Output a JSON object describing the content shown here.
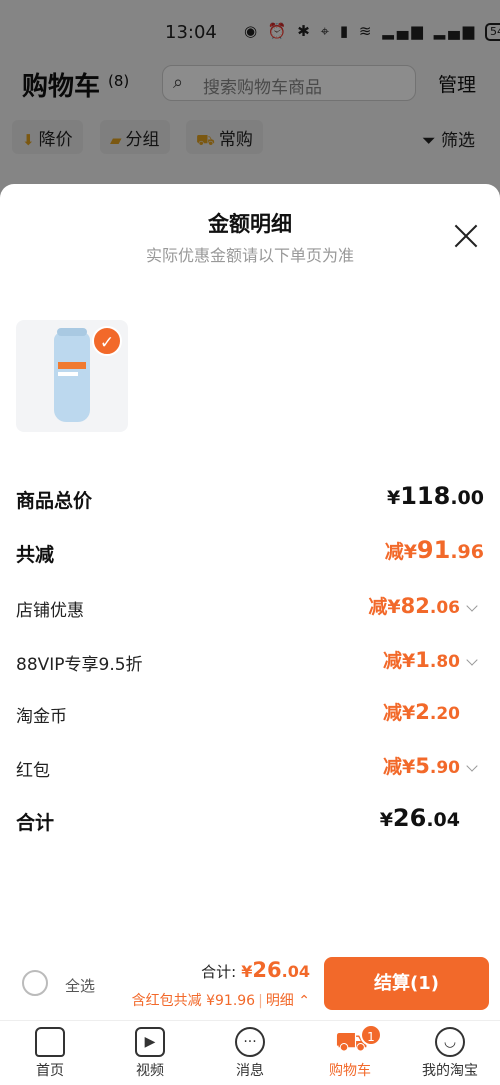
{
  "status_bar": {
    "time": "13:04",
    "battery": "54"
  },
  "cart_header": {
    "title": "购物车",
    "count": "(8)",
    "search_placeholder": "搜索购物车商品",
    "manage": "管理"
  },
  "chips": {
    "price_drop": "降价",
    "group": "分组",
    "frequent": "常购",
    "filter": "筛选"
  },
  "sheet": {
    "title": "金额明细",
    "subtitle": "实际优惠金额请以下单页为准",
    "rows": {
      "goods_total": {
        "label": "商品总价",
        "prefix": "¥",
        "int": "118",
        "dec": ".00"
      },
      "total_discount": {
        "label": "共减",
        "prefix": "减¥",
        "int": "91",
        "dec": ".96"
      },
      "shop_discount": {
        "label": "店铺优惠",
        "prefix": "减¥",
        "int": "82",
        "dec": ".06"
      },
      "vip_discount": {
        "label": "88VIP专享9.5折",
        "prefix": "减¥",
        "int": "1",
        "dec": ".80"
      },
      "taojinbi": {
        "label": "淘金币",
        "prefix": "减¥",
        "int": "2",
        "dec": ".20"
      },
      "red_packet": {
        "label": "红包",
        "prefix": "减¥",
        "int": "5",
        "dec": ".90"
      },
      "sum": {
        "label": "合计",
        "prefix": "¥",
        "int": "26",
        "dec": ".04"
      }
    }
  },
  "checkout": {
    "select_all": "全选",
    "total_label": "合计:",
    "total_prefix": "¥",
    "total_int": "26",
    "total_dec": ".04",
    "discount_note": "含红包共减 ¥91.96",
    "detail_link": "明细",
    "pay_button": "结算(1)"
  },
  "tabbar": {
    "home": "首页",
    "video": "视频",
    "messages": "消息",
    "cart": "购物车",
    "cart_badge": "1",
    "me": "我的淘宝"
  },
  "colors": {
    "accent": "#f2692a"
  }
}
